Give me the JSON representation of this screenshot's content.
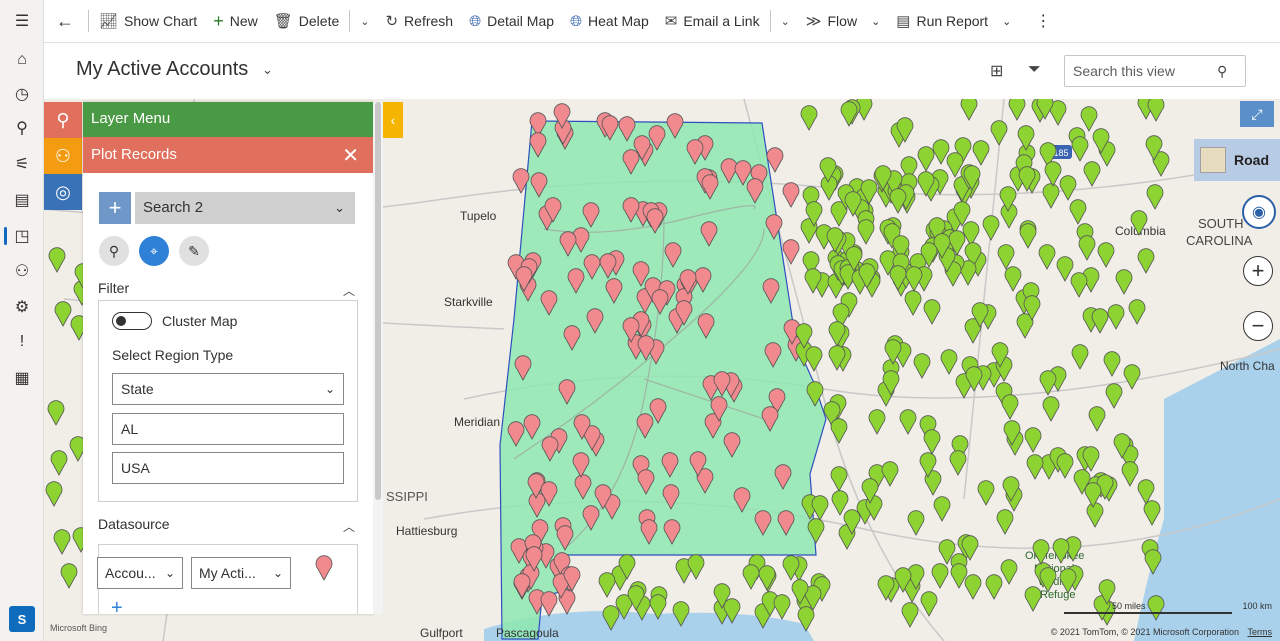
{
  "rail": {
    "avatar_initial": "S",
    "items": [
      "hamburger-icon",
      "home-icon",
      "recent-icon",
      "pin-icon",
      "dashboard-icon",
      "activities-icon",
      "maps-icon",
      "contacts-icon",
      "settings-icon",
      "alert-icon",
      "reports-icon"
    ]
  },
  "commandbar": {
    "show_chart": "Show Chart",
    "new": "New",
    "delete": "Delete",
    "refresh": "Refresh",
    "detail_map": "Detail Map",
    "heat_map": "Heat Map",
    "email_link": "Email a Link",
    "flow": "Flow",
    "run_report": "Run Report"
  },
  "header": {
    "title": "My Active Accounts",
    "search_placeholder": "Search this view"
  },
  "panel": {
    "layer_menu": "Layer Menu",
    "plot_records": "Plot Records",
    "search_selected": "Search 2",
    "filter_title": "Filter",
    "cluster_map_label": "Cluster Map",
    "region_type_label": "Select Region Type",
    "region_type_value": "State",
    "state_value": "AL",
    "country_value": "USA",
    "datasource_title": "Datasource",
    "entity_value": "Accou...",
    "view_value": "My Acti..."
  },
  "map": {
    "cities": [
      {
        "name": "Tupelo"
      },
      {
        "name": "Starkville"
      },
      {
        "name": "Meridian"
      },
      {
        "name": "Hattiesburg"
      },
      {
        "name": "Gulfport"
      },
      {
        "name": "Pascagoula"
      },
      {
        "name": "Columbia"
      },
      {
        "name": "SOUTH"
      },
      {
        "name": "CAROLINA"
      },
      {
        "name": "North Cha"
      },
      {
        "name": "Okefenokee"
      },
      {
        "name": "National"
      },
      {
        "name": "Wildlife"
      },
      {
        "name": "Refuge"
      },
      {
        "name": "SSIPPI"
      }
    ],
    "road_label": "Road",
    "scale_miles": "50 miles",
    "scale_km": "100 km",
    "attribution": "© 2021 TomTom, © 2021 Microsoft Corporation",
    "terms": "Terms",
    "bing": "Microsoft Bing",
    "highway_badge": "185",
    "colors": {
      "alabama_fill": "#8ee8b0",
      "red_pin": "#f08a8f",
      "green_pin": "#8dd433",
      "layer_green": "#4a9a45",
      "plot_red": "#e16f5d"
    }
  }
}
